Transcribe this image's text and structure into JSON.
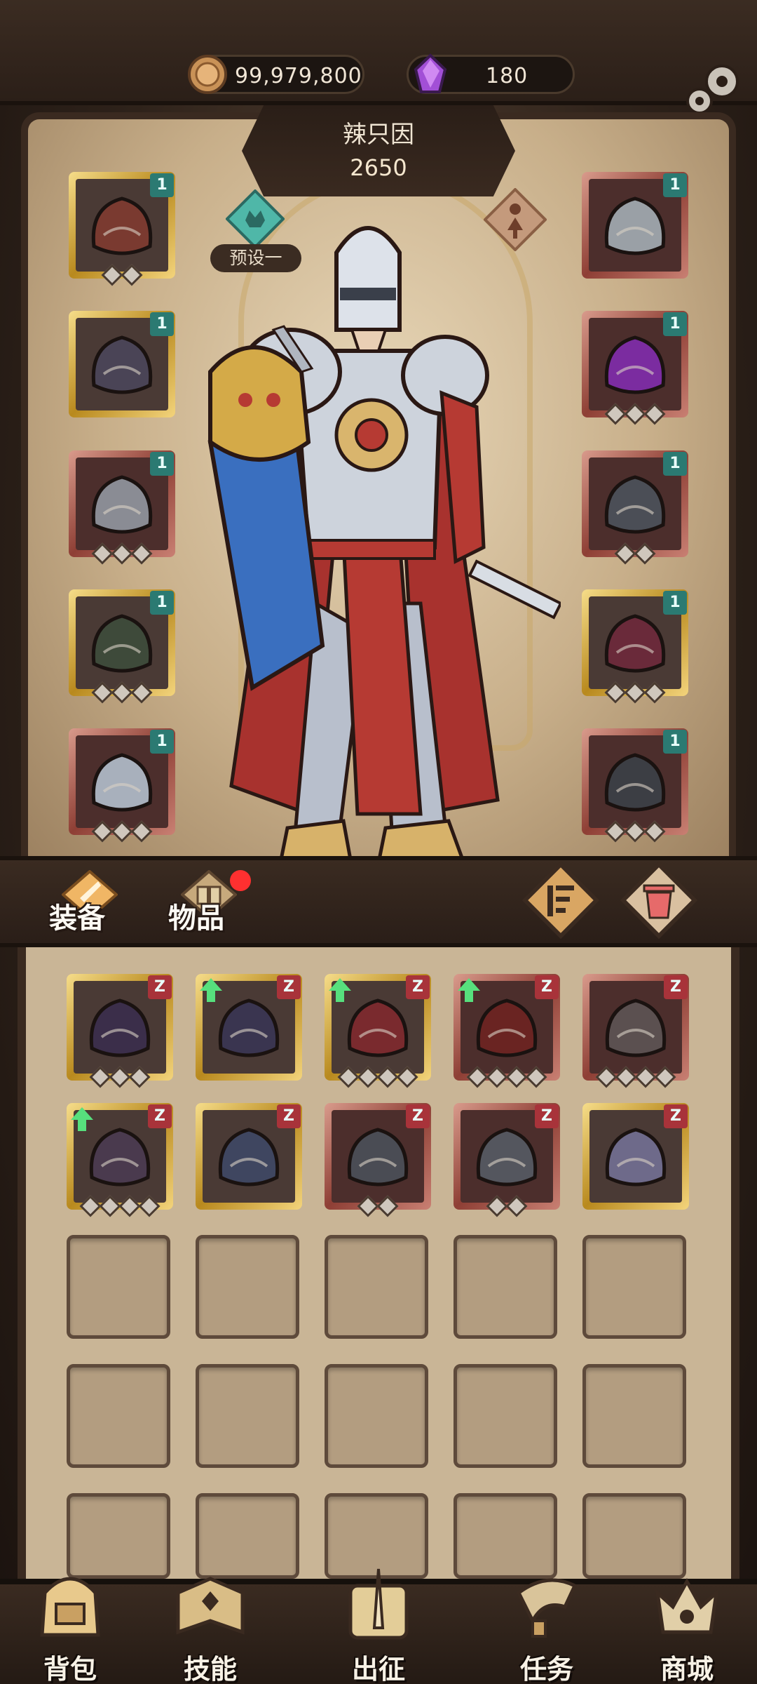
{
  "currency": {
    "coins": "99,979,800",
    "gems": "180"
  },
  "hero": {
    "name": "辣只因",
    "power": "2650",
    "preset_label": "预设一"
  },
  "equipment_left": [
    {
      "level": "1",
      "rarity": "gold",
      "stars": 2,
      "item_color": "#7a3a30"
    },
    {
      "level": "1",
      "rarity": "gold",
      "stars": 0,
      "item_color": "#4a4456"
    },
    {
      "level": "1",
      "rarity": "red",
      "stars": 3,
      "item_color": "#8a8c94"
    },
    {
      "level": "1",
      "rarity": "gold",
      "stars": 3,
      "item_color": "#3e4a3a"
    },
    {
      "level": "1",
      "rarity": "red",
      "stars": 3,
      "item_color": "#a8b0bc"
    }
  ],
  "equipment_right": [
    {
      "level": "1",
      "rarity": "red",
      "stars": 0,
      "item_color": "#9aa0a6"
    },
    {
      "level": "1",
      "rarity": "red",
      "stars": 3,
      "item_color": "#7b2ca0"
    },
    {
      "level": "1",
      "rarity": "red",
      "stars": 2,
      "item_color": "#4b4e56"
    },
    {
      "level": "1",
      "rarity": "gold",
      "stars": 3,
      "item_color": "#6a2a3a"
    },
    {
      "level": "1",
      "rarity": "red",
      "stars": 3,
      "item_color": "#3c3e44"
    }
  ],
  "tabs": {
    "equipment": "装备",
    "items": "物品"
  },
  "inventory": [
    {
      "level": "Z",
      "rarity": "gold",
      "stars": 3,
      "upgrade": false,
      "item_color": "#3b2e4a"
    },
    {
      "level": "Z",
      "rarity": "gold",
      "stars": 0,
      "upgrade": true,
      "item_color": "#3a3550"
    },
    {
      "level": "Z",
      "rarity": "gold",
      "stars": 4,
      "upgrade": true,
      "item_color": "#7a2a2e"
    },
    {
      "level": "Z",
      "rarity": "red",
      "stars": 4,
      "upgrade": true,
      "item_color": "#6a2422"
    },
    {
      "level": "Z",
      "rarity": "red",
      "stars": 4,
      "upgrade": false,
      "item_color": "#5b5050"
    },
    {
      "level": "Z",
      "rarity": "gold",
      "stars": 4,
      "upgrade": true,
      "item_color": "#4a3a4e"
    },
    {
      "level": "Z",
      "rarity": "gold",
      "stars": 0,
      "upgrade": false,
      "item_color": "#3f4660"
    },
    {
      "level": "Z",
      "rarity": "red",
      "stars": 2,
      "upgrade": false,
      "item_color": "#4a4c54"
    },
    {
      "level": "Z",
      "rarity": "red",
      "stars": 2,
      "upgrade": false,
      "item_color": "#54565e"
    },
    {
      "level": "Z",
      "rarity": "gold",
      "stars": 0,
      "upgrade": false,
      "item_color": "#6e6a8a"
    }
  ],
  "nav": [
    {
      "label": "背包",
      "icon": "backpack-icon"
    },
    {
      "label": "技能",
      "icon": "skill-book-icon"
    },
    {
      "label": "出征",
      "icon": "expedition-scroll-icon"
    },
    {
      "label": "任务",
      "icon": "quest-horn-icon"
    },
    {
      "label": "商城",
      "icon": "shop-crown-icon"
    }
  ]
}
